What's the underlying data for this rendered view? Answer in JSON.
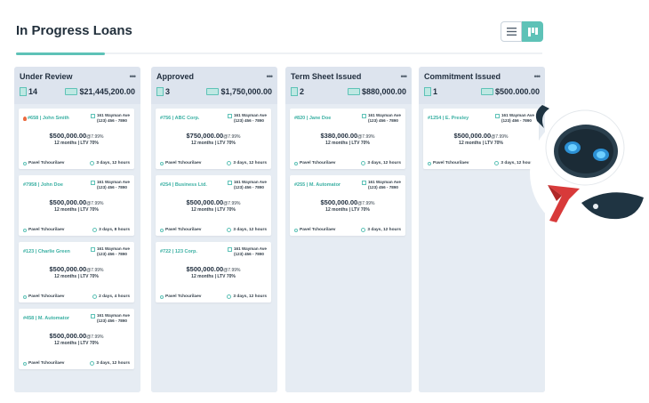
{
  "page": {
    "title": "In Progress Loans"
  },
  "view_toggle": {
    "list_icon": "list-icon",
    "board_icon": "kanban-icon",
    "active": "board"
  },
  "colors": {
    "accent": "#5ec2b7",
    "column_bg": "#dde4ee",
    "id_text": "#3bb0a3"
  },
  "columns": [
    {
      "title": "Under Review",
      "count": "14",
      "total": "$21,445,200.00",
      "cards": [
        {
          "id": "#658 | John Smith",
          "hot": true,
          "addr1": "161 Wayman Ave",
          "addr2": "(123) 456 - 7890",
          "amount": "$500,000.00",
          "rate": "@7.99%",
          "terms": "12 months | LTV 70%",
          "person": "Pavel Tchourilaev",
          "time": "3 days, 12 hours"
        },
        {
          "id": "#7958 | John Doe",
          "hot": false,
          "addr1": "161 Wayman Ave",
          "addr2": "(123) 456 - 7890",
          "amount": "$500,000.00",
          "rate": "@7.99%",
          "terms": "12 months | LTV 70%",
          "person": "Pavel Tchourilaev",
          "time": "3 days, 8 hours"
        },
        {
          "id": "#123 | Charlie Green",
          "hot": false,
          "addr1": "161 Wayman Ave",
          "addr2": "(123) 456 - 7890",
          "amount": "$500,000.00",
          "rate": "@7.99%",
          "terms": "12 months | LTV 70%",
          "person": "Pavel Tchourilaev",
          "time": "2 days, 4 hours"
        },
        {
          "id": "#458 | M. Automator",
          "hot": false,
          "addr1": "161 Wayman Ave",
          "addr2": "(123) 456 - 7890",
          "amount": "$500,000.00",
          "rate": "@7.99%",
          "terms": "12 months | LTV 70%",
          "person": "Pavel Tchourilaev",
          "time": "3 days, 12 hours"
        }
      ]
    },
    {
      "title": "Approved",
      "count": "3",
      "total": "$1,750,000.00",
      "cards": [
        {
          "id": "#756 | ABC Corp.",
          "hot": false,
          "addr1": "161 Wayman Ave",
          "addr2": "(123) 456 - 7890",
          "amount": "$750,000.00",
          "rate": "@7.99%",
          "terms": "12 months | LTV 70%",
          "person": "Pavel Tchourilaev",
          "time": "3 days, 12 hours"
        },
        {
          "id": "#254 | Business Ltd.",
          "hot": false,
          "addr1": "161 Wayman Ave",
          "addr2": "(123) 456 - 7890",
          "amount": "$500,000.00",
          "rate": "@7.99%",
          "terms": "12 months | LTV 70%",
          "person": "Pavel Tchourilaev",
          "time": "3 days, 12 hours"
        },
        {
          "id": "#722 | 123 Corp.",
          "hot": false,
          "addr1": "161 Wayman Ave",
          "addr2": "(123) 456 - 7890",
          "amount": "$500,000.00",
          "rate": "@7.99%",
          "terms": "12 months | LTV 70%",
          "person": "Pavel Tchourilaev",
          "time": "3 days, 12 hours"
        }
      ]
    },
    {
      "title": "Term Sheet Issued",
      "count": "2",
      "total": "$880,000.00",
      "cards": [
        {
          "id": "#820 | Jane Doe",
          "hot": false,
          "addr1": "161 Wayman Ave",
          "addr2": "(123) 456 - 7890",
          "amount": "$380,000.00",
          "rate": "@7.99%",
          "terms": "12 months | LTV 70%",
          "person": "Pavel Tchourilaev",
          "time": "3 days, 12 hours"
        },
        {
          "id": "#255 | M. Automator",
          "hot": false,
          "addr1": "161 Wayman Ave",
          "addr2": "(123) 456 - 7890",
          "amount": "$500,000.00",
          "rate": "@7.99%",
          "terms": "12 months | LTV 70%",
          "person": "Pavel Tchourilaev",
          "time": "3 days, 12 hours"
        }
      ]
    },
    {
      "title": "Commitment Issued",
      "count": "1",
      "total": "$500.000.00",
      "cards": [
        {
          "id": "#1254 | E. Presley",
          "hot": false,
          "addr1": "161 Wayman Ave",
          "addr2": "(123) 456 - 7890",
          "amount": "$500,000.00",
          "rate": "@7.99%",
          "terms": "12 months | LTV 70%",
          "person": "Pavel Tchourilaev",
          "time": "3 days, 12 hours"
        }
      ]
    }
  ]
}
